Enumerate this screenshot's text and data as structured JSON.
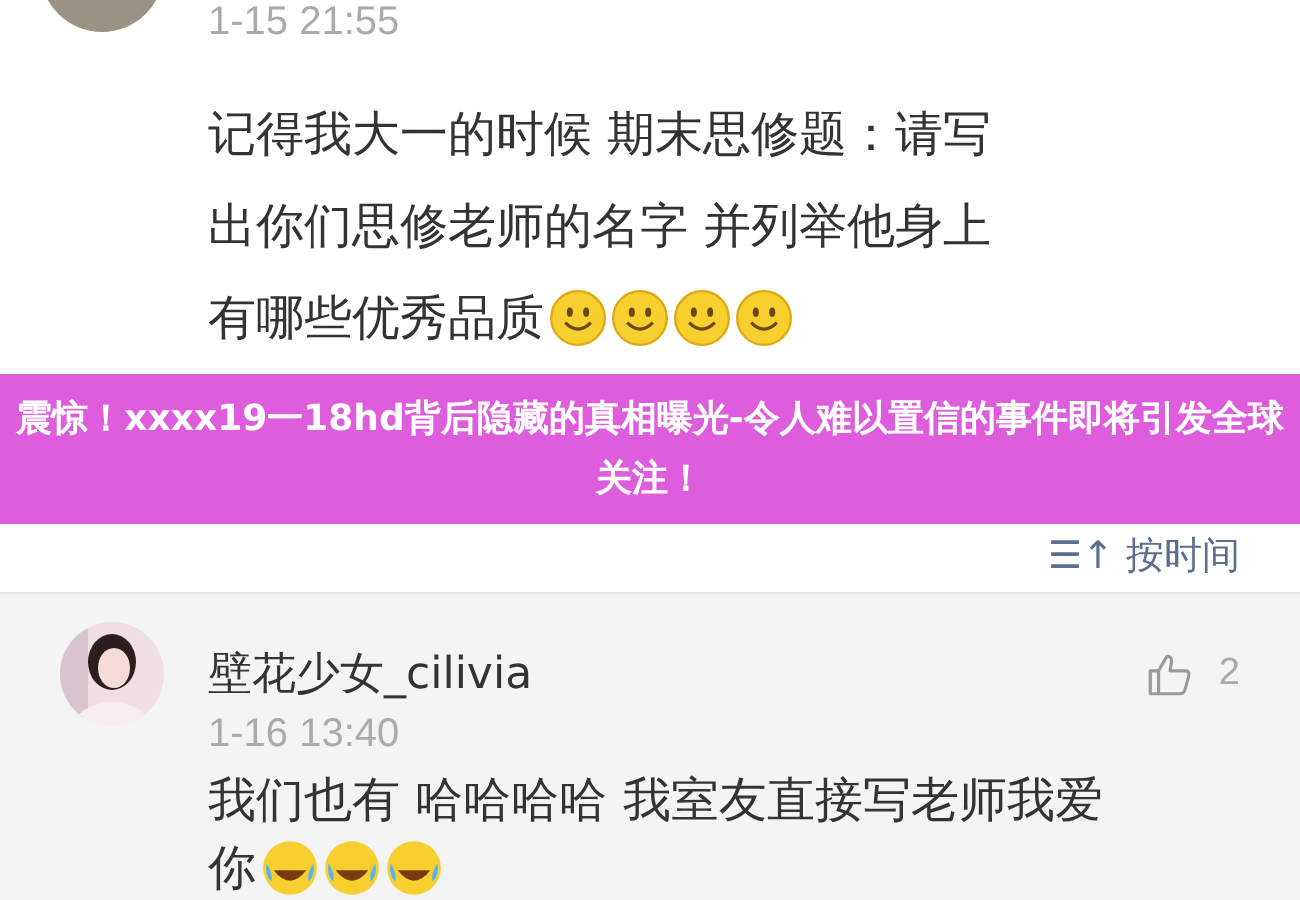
{
  "comments": [
    {
      "time": "1-15 21:55",
      "lines": [
        "记得我大一的时候 期末思修题：请写",
        "出你们思修老师的名字 并列举他身上",
        "有哪些优秀品质"
      ]
    },
    {
      "name": "壁花少女_cilivia",
      "likes": "2",
      "time": "1-16 13:40",
      "lines": [
        "我们也有 哈哈哈哈 我室友直接写老师我爱",
        "你"
      ]
    }
  ],
  "sort": {
    "icon": "☰↑",
    "label": "按时间"
  },
  "banner": "震惊！xxxx19一18hd背后隐藏的真相曝光-令人难以置信的事件即将引发全球关注！"
}
